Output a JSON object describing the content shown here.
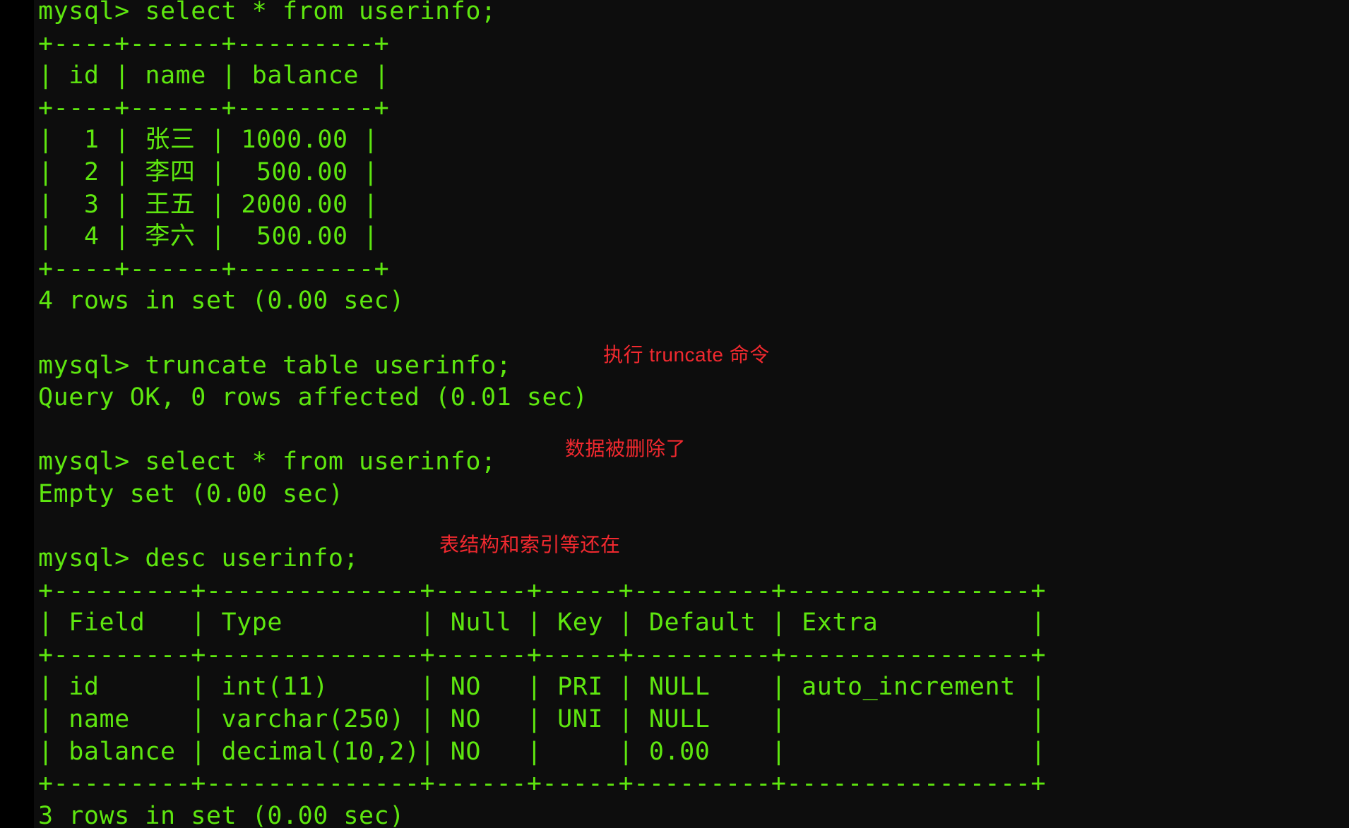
{
  "terminal": {
    "prompt": "mysql>",
    "background_color": "#0d0d0d",
    "text_color": "#5ee60f",
    "annotation_color": "#f1292f",
    "lines": [
      "mysql> select * from userinfo;",
      "+----+------+---------+",
      "| id | name | balance |",
      "+----+------+---------+",
      "|  1 | 张三 | 1000.00 |",
      "|  2 | 李四 |  500.00 |",
      "|  3 | 王五 | 2000.00 |",
      "|  4 | 李六 |  500.00 |",
      "+----+------+---------+",
      "4 rows in set (0.00 sec)",
      "",
      "mysql> truncate table userinfo;",
      "Query OK, 0 rows affected (0.01 sec)",
      "",
      "mysql> select * from userinfo;",
      "Empty set (0.00 sec)",
      "",
      "mysql> desc userinfo;",
      "+---------+--------------+------+-----+---------+----------------+",
      "| Field   | Type         | Null | Key | Default | Extra          |",
      "+---------+--------------+------+-----+---------+----------------+",
      "| id      | int(11)      | NO   | PRI | NULL    | auto_increment |",
      "| name    | varchar(250) | NO   | UNI | NULL    |                |",
      "| balance | decimal(10,2)| NO   |     | 0.00    |                |",
      "+---------+--------------+------+-----+---------+----------------+",
      "3 rows in set (0.00 sec)"
    ]
  },
  "commands": {
    "select_before": "select * from userinfo;",
    "truncate": "truncate table userinfo;",
    "select_after": "select * from userinfo;",
    "desc": "desc userinfo;"
  },
  "results": {
    "select_before_table": {
      "columns": [
        "id",
        "name",
        "balance"
      ],
      "rows": [
        [
          "1",
          "张三",
          "1000.00"
        ],
        [
          "2",
          "李四",
          "500.00"
        ],
        [
          "3",
          "王五",
          "2000.00"
        ],
        [
          "4",
          "李六",
          "500.00"
        ]
      ],
      "footer": "4 rows in set (0.00 sec)"
    },
    "truncate_result": "Query OK, 0 rows affected (0.01 sec)",
    "select_after_result": "Empty set (0.00 sec)",
    "desc_table": {
      "columns": [
        "Field",
        "Type",
        "Null",
        "Key",
        "Default",
        "Extra"
      ],
      "rows": [
        [
          "id",
          "int(11)",
          "NO",
          "PRI",
          "NULL",
          "auto_increment"
        ],
        [
          "name",
          "varchar(250)",
          "NO",
          "UNI",
          "NULL",
          ""
        ],
        [
          "balance",
          "decimal(10,2)",
          "NO",
          "",
          "0.00",
          ""
        ]
      ],
      "footer": "3 rows in set (0.00 sec)"
    }
  },
  "annotations": {
    "truncate_note": "执行 truncate 命令",
    "deleted_note": "数据被删除了",
    "structure_note": "表结构和索引等还在"
  }
}
